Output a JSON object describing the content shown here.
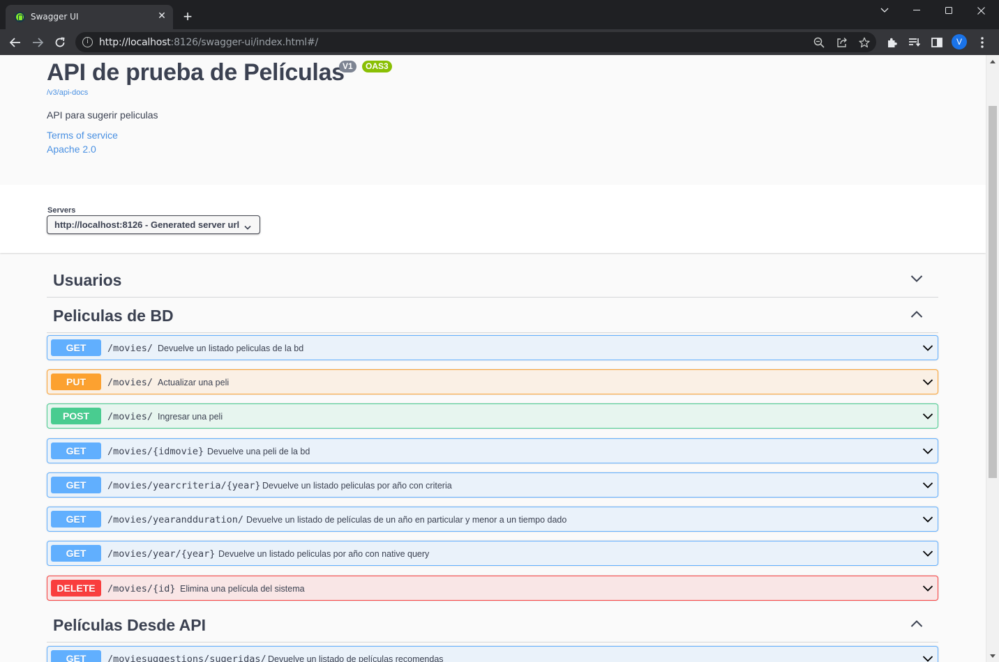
{
  "browser": {
    "tab_title": "Swagger UI",
    "url_host": "http://localhost",
    "url_rest": ":8126/swagger-ui/index.html#/",
    "profile_initial": "V"
  },
  "info": {
    "title": "API de prueba de Películas",
    "version_badge": "V1",
    "oas_badge": "OAS3",
    "api_docs_link": "/v3/api-docs",
    "description": "API para sugerir peliculas",
    "terms_link": "Terms of service",
    "license_link": "Apache 2.0"
  },
  "servers": {
    "label": "Servers",
    "selected": "http://localhost:8126 - Generated server url"
  },
  "tags": [
    {
      "name": "Usuarios",
      "expanded": false
    },
    {
      "name": "Peliculas de BD",
      "expanded": true
    },
    {
      "name": "Películas Desde API",
      "expanded": true
    }
  ],
  "operations": [
    {
      "method": "GET",
      "path": "/movies/",
      "summary": "Devuelve un listado peliculas de la bd"
    },
    {
      "method": "PUT",
      "path": "/movies/",
      "summary": "Actualizar una peli"
    },
    {
      "method": "POST",
      "path": "/movies/",
      "summary": "Ingresar una peli"
    },
    {
      "method": "GET",
      "path": "/movies/{idmovie}",
      "summary": "Devuelve una peli de la bd"
    },
    {
      "method": "GET",
      "path": "/movies/yearcriteria/{year}",
      "summary": "Devuelve un listado peliculas por año con criteria"
    },
    {
      "method": "GET",
      "path": "/movies/yearandduration/",
      "summary": "Devuelve un listado de películas de un año en particular y menor a un tiempo dado"
    },
    {
      "method": "GET",
      "path": "/movies/year/{year}",
      "summary": "Devuelve un listado peliculas por año con native query"
    },
    {
      "method": "DELETE",
      "path": "/movies/{id}",
      "summary": "Elimina una película del sistema"
    },
    {
      "method": "GET",
      "path": "/moviesuggestions/sugeridas/",
      "summary": "Devuelve un listado de películas recomendas"
    }
  ],
  "colors": {
    "get": "#61affe",
    "put": "#fca130",
    "post": "#49cc90",
    "delete": "#f93e3e",
    "text": "#3b4151",
    "link": "#4990e2"
  }
}
